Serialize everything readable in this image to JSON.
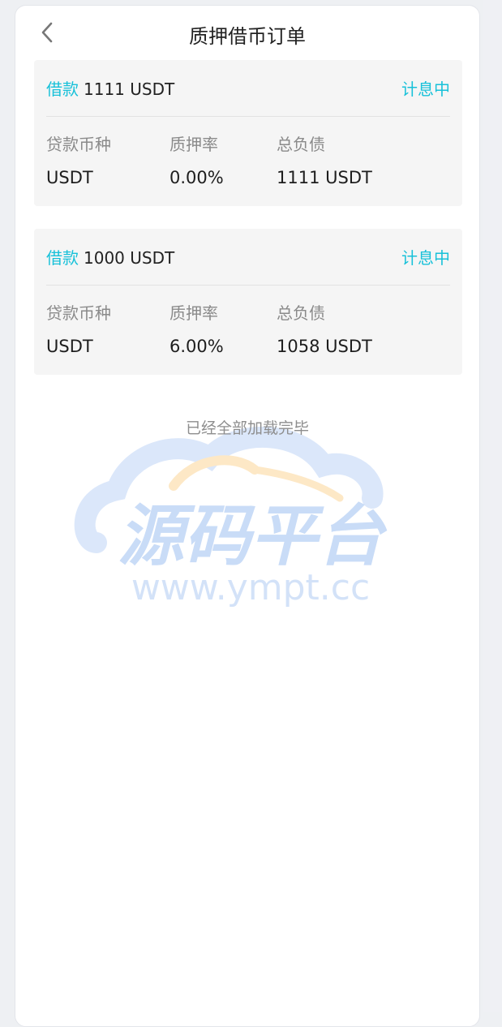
{
  "header": {
    "title": "质押借币订单",
    "back_icon": "chevron-left-icon"
  },
  "orders": [
    {
      "loan_label": "借款",
      "amount": "1111 USDT",
      "status": "计息中",
      "fields": [
        {
          "label": "贷款币种",
          "value": "USDT"
        },
        {
          "label": "质押率",
          "value": "0.00%"
        },
        {
          "label": "总负债",
          "value": "1111 USDT"
        }
      ]
    },
    {
      "loan_label": "借款",
      "amount": "1000 USDT",
      "status": "计息中",
      "fields": [
        {
          "label": "贷款币种",
          "value": "USDT"
        },
        {
          "label": "质押率",
          "value": "6.00%"
        },
        {
          "label": "总负债",
          "value": "1058 USDT"
        }
      ]
    }
  ],
  "list": {
    "end_text": "已经全部加载完毕"
  },
  "watermark": {
    "logo_text": "源码平台",
    "url_text": "www.ympt.cc"
  },
  "colors": {
    "accent": "#18c1d9",
    "watermark_blue": "#c9dcf7",
    "watermark_orange": "#fde3b8"
  }
}
